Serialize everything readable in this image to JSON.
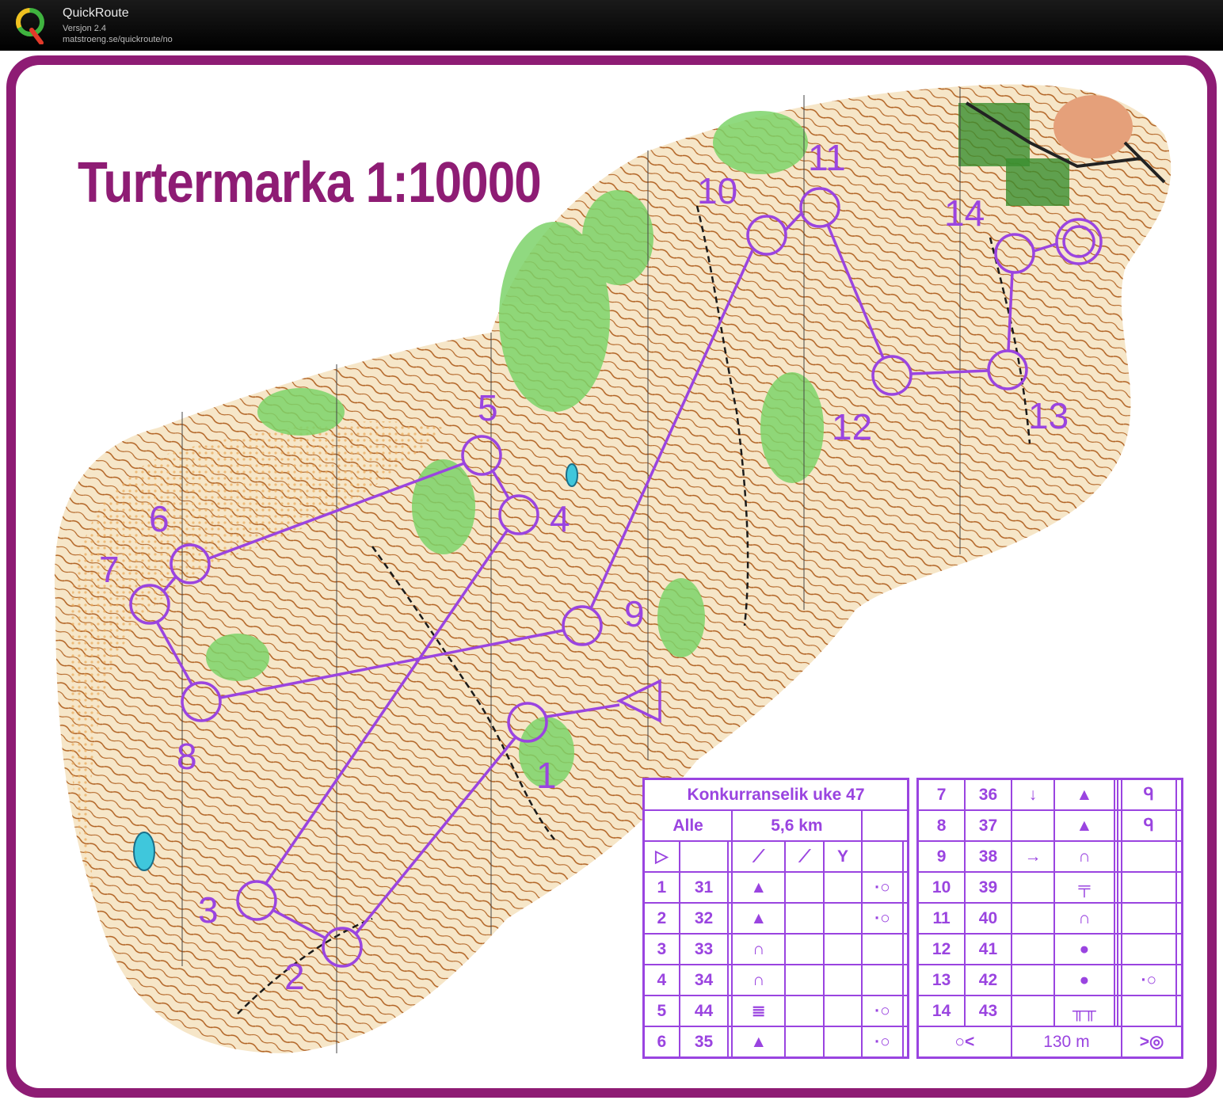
{
  "app": {
    "name": "QuickRoute",
    "version": "Versjon 2.4",
    "url": "matstroeng.se/quickroute/no"
  },
  "map": {
    "title": "Turtermarka 1:10000",
    "course_color": "#9a44e0",
    "frame_color": "#8e1c74",
    "control_numbers": [
      "1",
      "2",
      "3",
      "4",
      "5",
      "6",
      "7",
      "8",
      "9",
      "10",
      "11",
      "12",
      "13",
      "14"
    ]
  },
  "description": {
    "event": "Konkurranselik uke 47",
    "class": "Alle",
    "length": "5,6 km",
    "finish_distance": "130 m",
    "controls_left": [
      {
        "num": "1",
        "code": "31",
        "feature": "knoll-triangle",
        "extra": "dot-circle"
      },
      {
        "num": "2",
        "code": "32",
        "feature": "knoll-triangle",
        "extra": "dot-circle"
      },
      {
        "num": "3",
        "code": "33",
        "feature": "spur",
        "extra": ""
      },
      {
        "num": "4",
        "code": "34",
        "feature": "spur",
        "extra": ""
      },
      {
        "num": "5",
        "code": "44",
        "feature": "marsh",
        "extra": "dot-circle"
      },
      {
        "num": "6",
        "code": "35",
        "feature": "knoll-triangle",
        "extra": "dot-circle"
      }
    ],
    "controls_right": [
      {
        "num": "7",
        "code": "36",
        "dir": "↓",
        "feature": "knoll-triangle",
        "extra": "circle-q"
      },
      {
        "num": "8",
        "code": "37",
        "dir": "",
        "feature": "knoll-triangle",
        "extra": "circle-q"
      },
      {
        "num": "9",
        "code": "38",
        "dir": "→",
        "feature": "spur",
        "extra": ""
      },
      {
        "num": "10",
        "code": "39",
        "dir": "",
        "feature": "cliff",
        "extra": ""
      },
      {
        "num": "11",
        "code": "40",
        "dir": "",
        "feature": "spur",
        "extra": ""
      },
      {
        "num": "12",
        "code": "41",
        "dir": "",
        "feature": "boulder-dot",
        "extra": ""
      },
      {
        "num": "13",
        "code": "42",
        "dir": "",
        "feature": "boulder-dot",
        "extra": "dot-circle"
      },
      {
        "num": "14",
        "code": "43",
        "dir": "",
        "feature": "fence",
        "extra": ""
      }
    ]
  }
}
